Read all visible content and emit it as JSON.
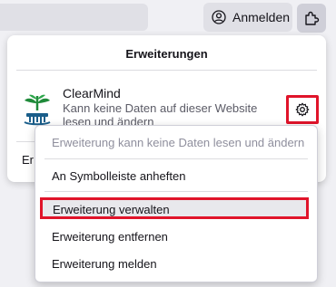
{
  "toolbar": {
    "signin_label": "Anmelden"
  },
  "panel": {
    "title": "Erweiterungen",
    "extension": {
      "name": "ClearMind",
      "description": "Kann keine Daten auf dieser Website lesen und ändern"
    },
    "footer_label": "Er"
  },
  "context_menu": {
    "items": [
      {
        "label": "Erweiterung kann keine Daten lesen und ändern",
        "disabled": true
      },
      {
        "label": "An Symbolleiste anheften"
      },
      {
        "label": "Erweiterung verwalten",
        "highlighted": true
      },
      {
        "label": "Erweiterung entfernen"
      },
      {
        "label": "Erweiterung melden"
      }
    ]
  },
  "colors": {
    "highlight_border": "#e0142a",
    "logo_green": "#1f8a3a",
    "logo_blue": "#1a5e8a"
  }
}
